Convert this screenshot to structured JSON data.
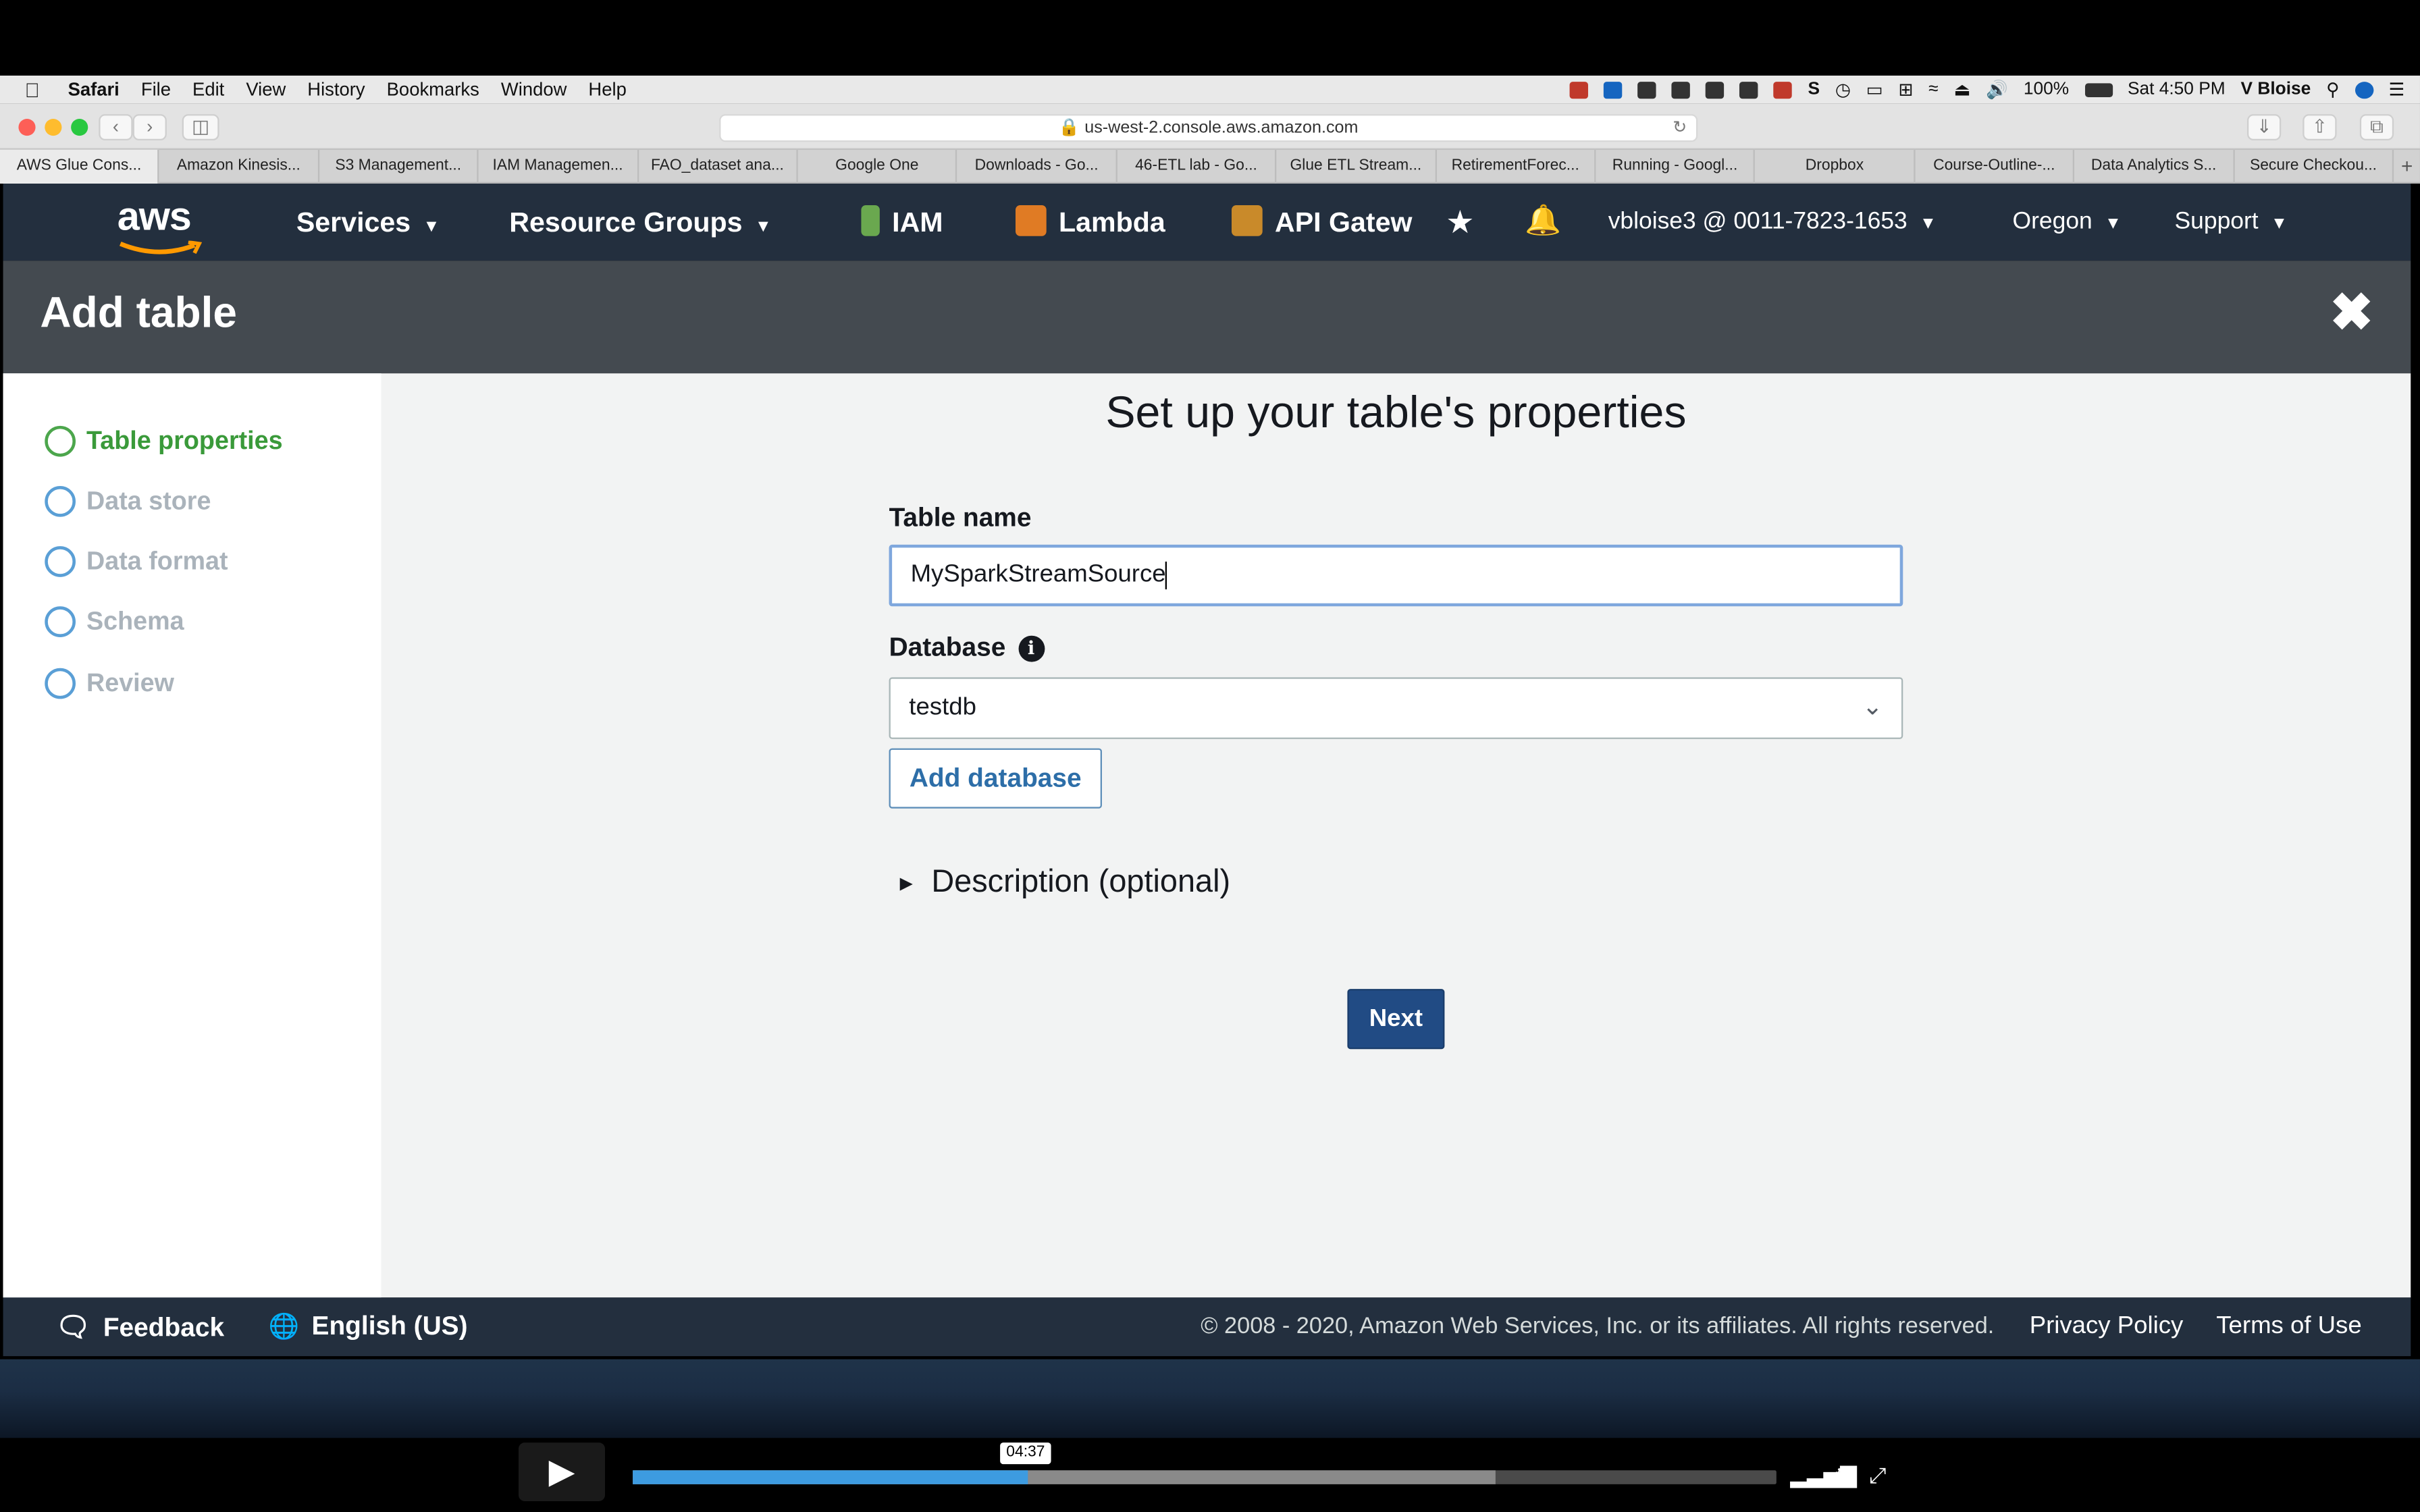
{
  "menubar": {
    "app": "Safari",
    "items": [
      "File",
      "Edit",
      "View",
      "History",
      "Bookmarks",
      "Window",
      "Help"
    ],
    "battery": "100%",
    "clock": "Sat 4:50 PM",
    "user": "V Bloise"
  },
  "browser": {
    "url": "us-west-2.console.aws.amazon.com",
    "tabs": [
      "AWS Glue Cons...",
      "Amazon Kinesis...",
      "S3 Management...",
      "IAM Managemen...",
      "FAO_dataset ana...",
      "Google One",
      "Downloads - Go...",
      "46-ETL lab - Go...",
      "Glue ETL Stream...",
      "RetirementForec...",
      "Running - Googl...",
      "Dropbox",
      "Course-Outline-...",
      "Data Analytics S...",
      "Secure Checkou..."
    ]
  },
  "awsnav": {
    "logo": "aws",
    "services": "Services",
    "resource_groups": "Resource Groups",
    "pin_iam": "IAM",
    "pin_lambda": "Lambda",
    "pin_api": "API Gatew",
    "account": "vbloise3 @ 0011-7823-1653",
    "region": "Oregon",
    "support": "Support",
    "colors": {
      "nav_bg": "#232f3e",
      "lambda": "#e07b24",
      "api": "#c98a2a",
      "iam": "#6aa84f"
    }
  },
  "modal": {
    "title": "Add table",
    "steps": [
      "Table properties",
      "Data store",
      "Data format",
      "Schema",
      "Review"
    ],
    "active_step": 0,
    "heading": "Set up your table's properties",
    "table_name_label": "Table name",
    "table_name_value": "MySparkStreamSource",
    "database_label": "Database",
    "database_value": "testdb",
    "add_database": "Add database",
    "description": "Description (optional)",
    "next": "Next"
  },
  "footer": {
    "feedback": "Feedback",
    "language": "English (US)",
    "copyright": "© 2008 - 2020, Amazon Web Services, Inc. or its affiliates. All rights reserved.",
    "privacy": "Privacy Policy",
    "terms": "Terms of Use"
  },
  "player": {
    "time": "04:37",
    "played_fraction": 0.345,
    "buffered_fraction": 0.755
  }
}
